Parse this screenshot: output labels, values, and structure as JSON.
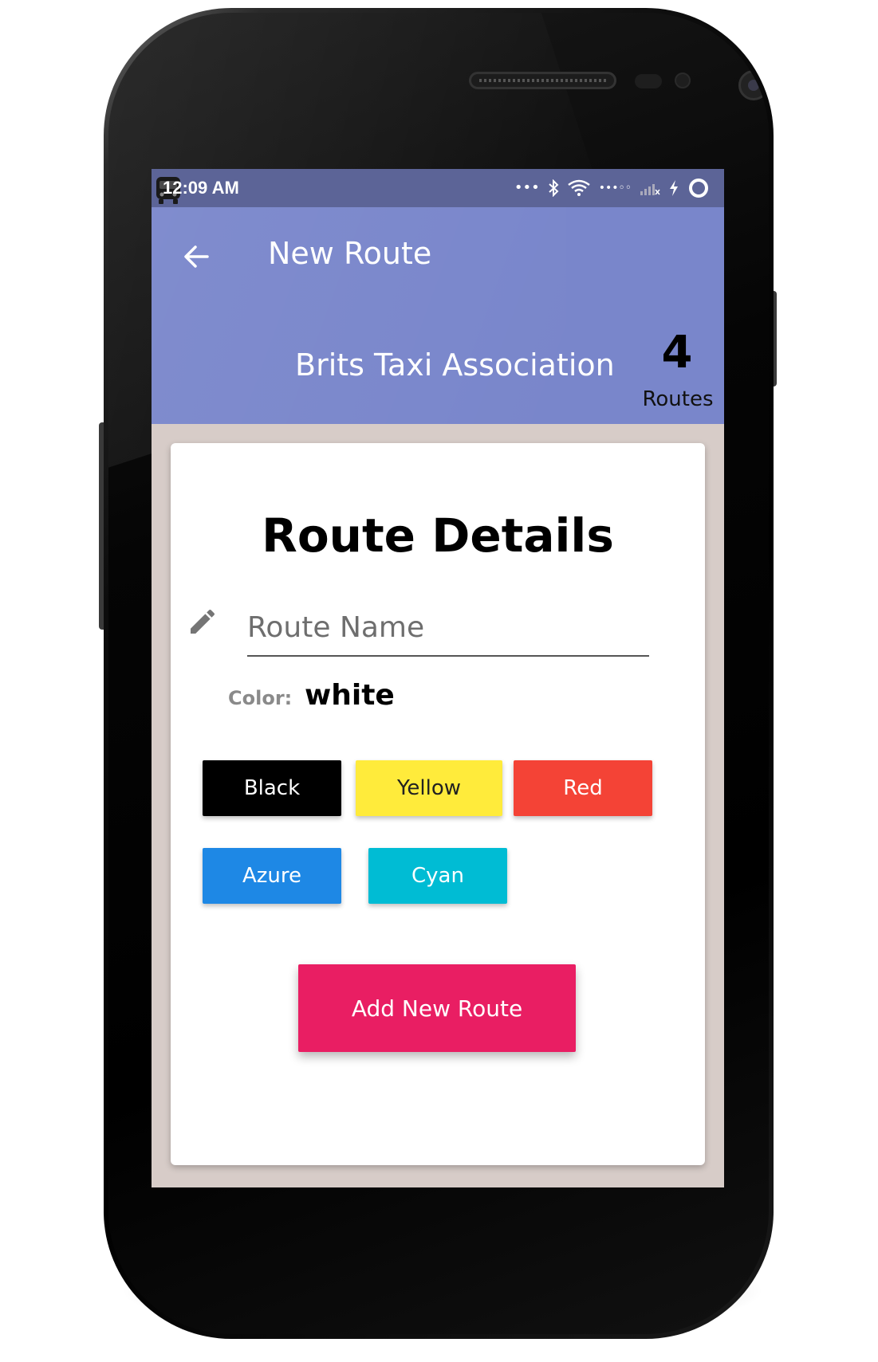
{
  "status_bar": {
    "time": "12:09 AM",
    "app_icon": "bus-icon",
    "icons": [
      "more-dots-icon",
      "bluetooth-icon",
      "wifi-icon",
      "signal-dots-icon",
      "signal-bars-icon",
      "charging-icon",
      "battery-circle-icon"
    ]
  },
  "app_bar": {
    "title": "New Route",
    "back_icon": "arrow-back-icon",
    "association_name": "Brits Taxi Association",
    "route_count": "4",
    "route_count_label": "Routes"
  },
  "card": {
    "title": "Route Details",
    "route_name_placeholder": "Route Name",
    "route_name_value": "",
    "color_label": "Color:",
    "color_value": "white",
    "color_buttons": [
      {
        "label": "Black",
        "color": "#000000"
      },
      {
        "label": "Yellow",
        "color": "#ffeb3b"
      },
      {
        "label": "Red",
        "color": "#f44336"
      },
      {
        "label": "Azure",
        "color": "#1e88e5"
      },
      {
        "label": "Cyan",
        "color": "#00bcd4"
      }
    ],
    "submit_label": "Add New Route"
  },
  "colors": {
    "status_bar": "#5c6497",
    "app_bar": "#7986cb",
    "screen_background": "#d7ccc8",
    "accent": "#e91e63"
  }
}
